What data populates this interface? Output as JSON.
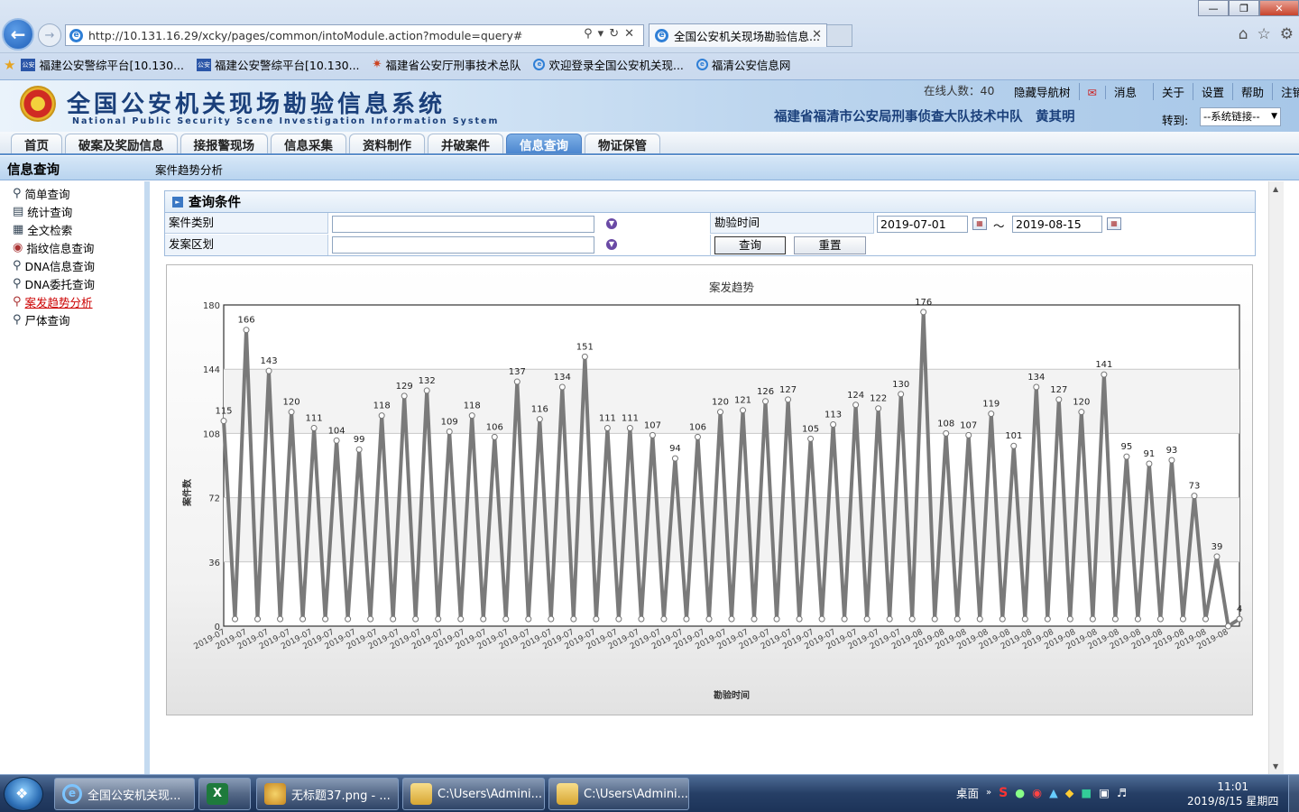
{
  "browser": {
    "url": "http://10.131.16.29/xcky/pages/common/intoModule.action?module=query#",
    "tab_title": "全国公安机关现场勘验信息...",
    "favorites": [
      "福建公安警综平台[10.130...",
      "福建公安警综平台[10.130...",
      "福建省公安厅刑事技术总队",
      "欢迎登录全国公安机关现...",
      "福清公安信息网"
    ]
  },
  "header": {
    "system_title": "全国公安机关现场勘验信息系统",
    "system_subtitle": "National Public Security Scene Investigation Information System",
    "online_count": "在线人数：40",
    "links": [
      "隐藏导航树",
      "消息",
      "关于",
      "设置",
      "帮助",
      "注销"
    ],
    "organization": "福建省福清市公安局刑事侦查大队技术中队　黄其明",
    "goto_label": "转到:",
    "goto_value": "--系统链接--"
  },
  "nav": {
    "tabs": [
      "首页",
      "破案及奖励信息",
      "接报警现场",
      "信息采集",
      "资料制作",
      "并破案件",
      "信息查询",
      "物证保管"
    ],
    "active_index": 6
  },
  "section": {
    "title": "信息查询",
    "breadcrumb": "案件趋势分析"
  },
  "sidebar": {
    "items": [
      "简单查询",
      "统计查询",
      "全文检索",
      "指纹信息查询",
      "DNA信息查询",
      "DNA委托查询",
      "案发趋势分析",
      "尸体查询"
    ],
    "active_index": 6
  },
  "query": {
    "title": "查询条件",
    "case_type_label": "案件类别",
    "case_type_value": "",
    "area_label": "发案区划",
    "area_value": "",
    "time_label": "勘验时间",
    "date_from": "2019-07-01",
    "date_sep": "～",
    "date_to": "2019-08-15",
    "search_btn": "查询",
    "reset_btn": "重置"
  },
  "chart_data": {
    "type": "line",
    "title": "案发趋势",
    "xlabel": "勘验时间",
    "ylabel": "案件数",
    "ylim": [
      0,
      180
    ],
    "yticks": [
      0,
      36,
      72,
      108,
      144,
      180
    ],
    "x": [
      "2019-07-01",
      "2019-07-01",
      "2019-07-02",
      "2019-07-02",
      "2019-07-03",
      "2019-07-03",
      "2019-07-04",
      "2019-07-04",
      "2019-07-05",
      "2019-07-05",
      "2019-07-06",
      "2019-07-06",
      "2019-07-07",
      "2019-07-07",
      "2019-07-08",
      "2019-07-08",
      "2019-07-09",
      "2019-07-09",
      "2019-07-10",
      "2019-07-10",
      "2019-07-11",
      "2019-07-11",
      "2019-07-12",
      "2019-07-12",
      "2019-07-13",
      "2019-07-13",
      "2019-07-14",
      "2019-07-14",
      "2019-07-15",
      "2019-07-15",
      "2019-07-16",
      "2019-07-16",
      "2019-07-17",
      "2019-07-17",
      "2019-07-18",
      "2019-07-18",
      "2019-07-19",
      "2019-07-19",
      "2019-07-20",
      "2019-07-20",
      "2019-07-21",
      "2019-07-21",
      "2019-07-22",
      "2019-07-22",
      "2019-07-23",
      "2019-07-23",
      "2019-07-24",
      "2019-07-24",
      "2019-07-25",
      "2019-07-25",
      "2019-07-26",
      "2019-07-26",
      "2019-07-27",
      "2019-07-27",
      "2019-07-28",
      "2019-07-28",
      "2019-07-29",
      "2019-07-29",
      "2019-07-30",
      "2019-07-30",
      "2019-07-31",
      "2019-07-31",
      "2019-08-01",
      "2019-08-01",
      "2019-08-02",
      "2019-08-02",
      "2019-08-03",
      "2019-08-03",
      "2019-08-04",
      "2019-08-04",
      "2019-08-05",
      "2019-08-05",
      "2019-08-06",
      "2019-08-06",
      "2019-08-07",
      "2019-08-07",
      "2019-08-08",
      "2019-08-08",
      "2019-08-09",
      "2019-08-09",
      "2019-08-10",
      "2019-08-10",
      "2019-08-11",
      "2019-08-11",
      "2019-08-12",
      "2019-08-12",
      "2019-08-13",
      "2019-08-13",
      "2019-08-14",
      "2019-08-14",
      "2019-08-15",
      "2019-08-15"
    ],
    "tick_labels": [
      "2019-07",
      "2019-07",
      "2019-07",
      "2019-07",
      "2019-07",
      "2019-07",
      "2019-07",
      "2019-07",
      "2019-07",
      "2019-07",
      "2019-07",
      "2019-07",
      "2019-07",
      "2019-07",
      "2019-07",
      "2019-07",
      "2019-07",
      "2019-07",
      "2019-07",
      "2019-07",
      "2019-07",
      "2019-07",
      "2019-07",
      "2019-07",
      "2019-07",
      "2019-07",
      "2019-07",
      "2019-07",
      "2019-07",
      "2019-07",
      "2019-07",
      "2019-07",
      "2019-08",
      "2019-08",
      "2019-08",
      "2019-08",
      "2019-08",
      "2019-08",
      "2019-08",
      "2019-08",
      "2019-08",
      "2019-08",
      "2019-08",
      "2019-08",
      "2019-08",
      "2019-08",
      "2019-08"
    ],
    "values": [
      115,
      4,
      166,
      4,
      143,
      4,
      120,
      4,
      111,
      4,
      104,
      4,
      99,
      4,
      118,
      4,
      129,
      4,
      132,
      4,
      109,
      4,
      118,
      4,
      106,
      4,
      137,
      4,
      116,
      4,
      134,
      4,
      151,
      4,
      111,
      4,
      111,
      4,
      107,
      4,
      94,
      4,
      106,
      4,
      120,
      4,
      121,
      4,
      126,
      4,
      127,
      4,
      105,
      4,
      113,
      4,
      124,
      4,
      122,
      4,
      130,
      4,
      176,
      4,
      108,
      4,
      107,
      4,
      119,
      4,
      101,
      4,
      134,
      4,
      127,
      4,
      120,
      4,
      141,
      4,
      95,
      4,
      91,
      4,
      93,
      4,
      73,
      4,
      39,
      0,
      4
    ],
    "series_color": "#7a7a7a",
    "grid": true,
    "legend": "none"
  },
  "taskbar": {
    "items": [
      "全国公安机关现...",
      "",
      "无标题37.png - ...",
      "C:\\Users\\Admini...",
      "C:\\Users\\Admini..."
    ],
    "desktop_label": "桌面",
    "time": "11:01",
    "date": "2019/8/15 星期四"
  }
}
